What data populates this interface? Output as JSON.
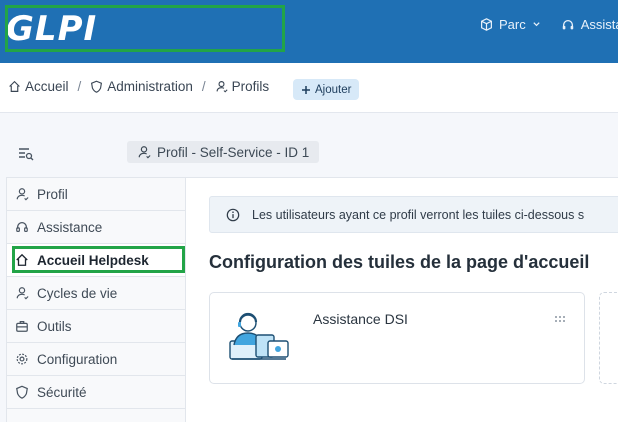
{
  "app": {
    "logo_text": "GLPI"
  },
  "top_nav": {
    "items": [
      {
        "label": "Parc",
        "icon": "box-icon"
      },
      {
        "label": "Assistance",
        "icon": "headset-icon"
      }
    ]
  },
  "breadcrumb": {
    "items": [
      {
        "label": "Accueil",
        "icon": "home-icon"
      },
      {
        "label": "Administration",
        "icon": "shield-icon"
      },
      {
        "label": "Profils",
        "icon": "user-icon"
      }
    ],
    "separator": "/"
  },
  "toolbar": {
    "add_label": "Ajouter"
  },
  "profile": {
    "title": "Profil - Self-Service - ID 1"
  },
  "tabs": {
    "items": [
      {
        "label": "Profil",
        "icon": "user-icon"
      },
      {
        "label": "Assistance",
        "icon": "headset-icon"
      },
      {
        "label": "Accueil Helpdesk",
        "icon": "home-icon",
        "active": true
      },
      {
        "label": "Cycles de vie",
        "icon": "user-icon"
      },
      {
        "label": "Outils",
        "icon": "briefcase-icon"
      },
      {
        "label": "Configuration",
        "icon": "gear-icon"
      },
      {
        "label": "Sécurité",
        "icon": "shield-icon"
      }
    ]
  },
  "main": {
    "info_text": "Les utilisateurs ayant ce profil verront les tuiles ci-dessous s",
    "section_title": "Configuration des tuiles de la page d'accueil",
    "tiles": [
      {
        "title": "Assistance DSI"
      }
    ]
  },
  "colors": {
    "header": "#1f70b4",
    "highlight": "#22a447",
    "add_button": "#d7e9f8"
  }
}
